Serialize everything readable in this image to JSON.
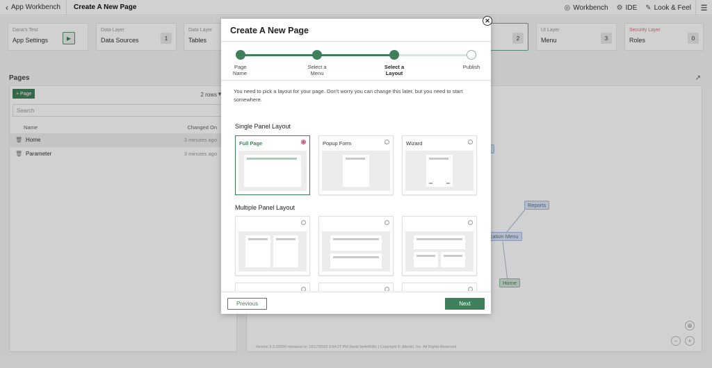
{
  "topbar": {
    "back_label": "App Workbench",
    "page_title": "Create A New Page",
    "workbench_label": "Workbench",
    "ide_label": "IDE",
    "look_feel_label": "Look & Feel"
  },
  "cards": [
    {
      "layer": "Dana's Test",
      "name": "App Settings"
    },
    {
      "layer": "Data Layer",
      "name": "Data Sources",
      "count": "1"
    },
    {
      "layer": "Data Layer",
      "name": "Tables"
    },
    {
      "count": "2"
    },
    {
      "layer": "UI Layer",
      "name": "Menu",
      "count": "3"
    },
    {
      "layer": "Security Layer",
      "name": "Roles",
      "count": "0"
    }
  ],
  "pages": {
    "title": "Pages",
    "add_label": "+ Page",
    "rows_label": "2 rows",
    "search_placeholder": "Search",
    "col_name": "Name",
    "col_changed": "Changed On",
    "items": [
      {
        "name": "Home",
        "changed": "3 minutes ago"
      },
      {
        "name": "Parameter",
        "changed": "3 minutes ago"
      }
    ]
  },
  "diagram": {
    "nodes": [
      "e",
      "Reports",
      "ication Menu",
      "Home"
    ]
  },
  "footer": "Version 3.3.33398 released on 10/17/2023 3:54:27 PM (build 9e4ef09b) | Copyright © Jitterbit, Inc. All Rights Reserved",
  "modal": {
    "title": "Create A New Page",
    "steps": [
      {
        "label_line1": "Page",
        "label_line2": "Name",
        "state": "done"
      },
      {
        "label_line1": "Select a",
        "label_line2": "Menu",
        "state": "done"
      },
      {
        "label_line1": "Select a",
        "label_line2": "Layout",
        "state": "active"
      },
      {
        "label_line1": "Publish",
        "label_line2": "",
        "state": "todo"
      }
    ],
    "intro": "You need to pick a layout for your page. Don't worry you can change this later, but you need to start somewhere.",
    "single_title": "Single Panel Layout",
    "multiple_title": "Multiple Panel Layout",
    "layouts": {
      "full_page": "Full Page",
      "popup_form": "Popup Form",
      "wizard": "Wizard"
    },
    "prev_label": "Previous",
    "next_label": "Next"
  },
  "colors": {
    "accent": "#3f7f5a",
    "radio_selected": "#c8508a",
    "node_blue": "#dde5f5",
    "node_green": "#cfe3d7"
  }
}
